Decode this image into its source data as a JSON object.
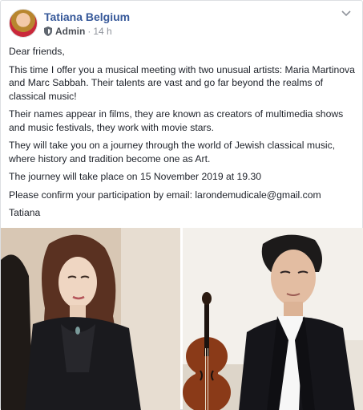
{
  "post": {
    "author": "Tatiana Belgium",
    "role": "Admin",
    "separator": "·",
    "time": "14 h",
    "icons": {
      "avatar": "profile-photo",
      "role": "shield-icon",
      "menu": "chevron-down-icon"
    },
    "paragraphs": [
      "Dear friends,",
      "This time I offer you a musical meeting with two unusual artists: Maria Martinova and Marc Sabbah. Their talents are vast and go far beyond the realms of classical music!",
      "Their names appear in films, they are known as creators of multimedia shows and music festivals, they work with movie stars.",
      "They will take you on a journey through the world of Jewish classical music, where history and tradition become one as Art.",
      "The journey will take place on 15 November 2019 at 19.30",
      "Please confirm your participation by email: larondemudicale@gmail.com",
      "Tatiana"
    ],
    "photos": [
      {
        "subject": "woman-portrait"
      },
      {
        "subject": "man-with-violin-portrait"
      }
    ]
  },
  "colors": {
    "author_link": "#365899",
    "meta_gray": "#90949c",
    "text": "#1d2129",
    "border": "#dddfe2"
  }
}
